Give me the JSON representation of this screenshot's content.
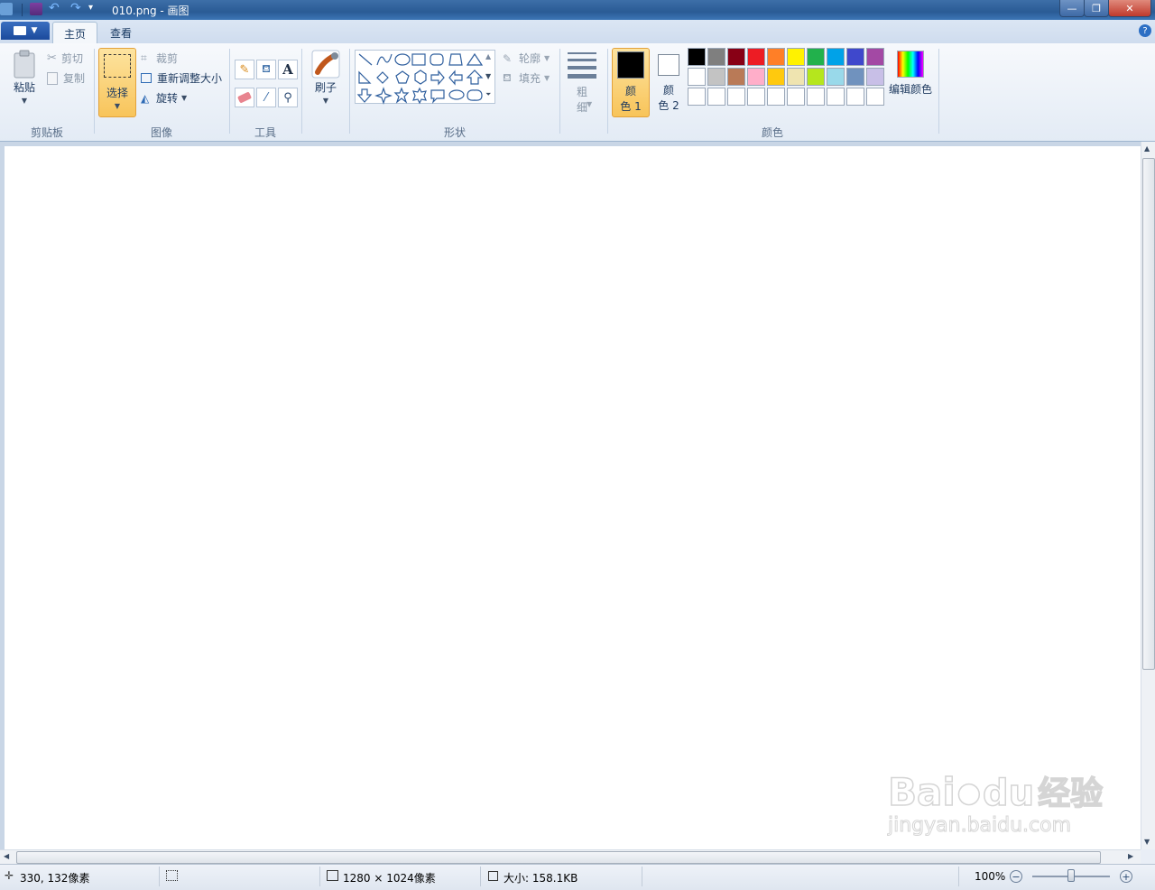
{
  "window": {
    "title": "010.png - 画图",
    "controls": {
      "minimize": "—",
      "maximize": "❐",
      "close": "✕"
    }
  },
  "tabs": {
    "home": "主页",
    "view": "查看"
  },
  "help_label": "?",
  "clipboard": {
    "paste": "粘贴",
    "cut": "剪切",
    "copy": "复制",
    "group": "剪贴板"
  },
  "image": {
    "select": "选择",
    "crop": "裁剪",
    "resize": "重新调整大小",
    "rotate": "旋转",
    "group": "图像"
  },
  "tools": {
    "group": "工具"
  },
  "brushes": {
    "label": "刷子"
  },
  "shapes": {
    "outline": "轮廓",
    "fill": "填充",
    "group": "形状"
  },
  "size": {
    "line1": "粗",
    "line2": "细"
  },
  "colors": {
    "color1_line1": "颜",
    "color1_line2": "色 1",
    "color2_line1": "颜",
    "color2_line2": "色 2",
    "edit": "编辑颜色",
    "group": "颜色",
    "row1": [
      "#000000",
      "#7f7f7f",
      "#880015",
      "#ed1c24",
      "#ff7f27",
      "#fff200",
      "#22b14c",
      "#00a2e8",
      "#3f48cc",
      "#a349a4"
    ],
    "row2": [
      "#ffffff",
      "#c3c3c3",
      "#b97a57",
      "#ffaec9",
      "#ffc90e",
      "#efe4b0",
      "#b5e61d",
      "#99d9ea",
      "#7092be",
      "#c8bfe7"
    ],
    "color1_value": "#000000",
    "color2_value": "#ffffff"
  },
  "status": {
    "position": "330, 132像素",
    "dimensions": "1280 × 1024像素",
    "filesize": "大小: 158.1KB",
    "zoom": "100%",
    "zoom_slider_level": 0.5
  },
  "watermark": {
    "brand": "Bai",
    "du": "du",
    "cn": "经验",
    "url": "jingyan.baidu.com"
  }
}
